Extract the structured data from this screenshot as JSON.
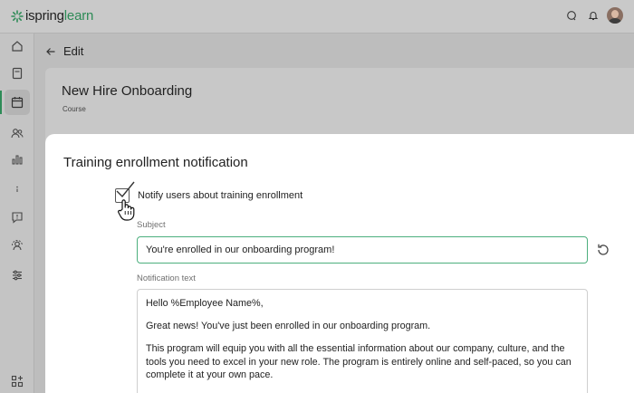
{
  "app": {
    "logo_word1": "ispring",
    "logo_word2": "learn",
    "brand_color": "#2e8b57"
  },
  "topbar": {
    "icons": [
      "chat-icon",
      "bell-icon",
      "user-avatar"
    ]
  },
  "sidebar": {
    "items": [
      {
        "icon": "home-icon",
        "active": false
      },
      {
        "icon": "book-icon",
        "active": false
      },
      {
        "icon": "calendar-icon",
        "active": true
      },
      {
        "icon": "users-icon",
        "active": false
      },
      {
        "icon": "bar-chart-icon",
        "active": false
      },
      {
        "icon": "info-icon",
        "active": false
      },
      {
        "icon": "feedback-icon",
        "active": false
      },
      {
        "icon": "user-settings-icon",
        "active": false
      },
      {
        "icon": "sliders-icon",
        "active": false
      },
      {
        "icon": "add-apps-icon",
        "active": false
      }
    ]
  },
  "header": {
    "back_title": "Edit",
    "course_title": "New Hire Onboarding",
    "course_type": "Course"
  },
  "panel": {
    "title": "Training enrollment notification",
    "notify_label": "Notify users about training enrollment",
    "notify_checked": true,
    "subject_label": "Subject",
    "subject_value": "You're enrolled in our onboarding program!",
    "text_label": "Notification text",
    "text_paragraphs": [
      "Hello %Employee Name%,",
      "Great news! You've just been enrolled in our onboarding program.",
      "This program will equip you with all the essential information about our company, culture, and the tools you need to excel in your new role. The program is entirely online and self-paced, so you can complete it at your own pace."
    ]
  }
}
